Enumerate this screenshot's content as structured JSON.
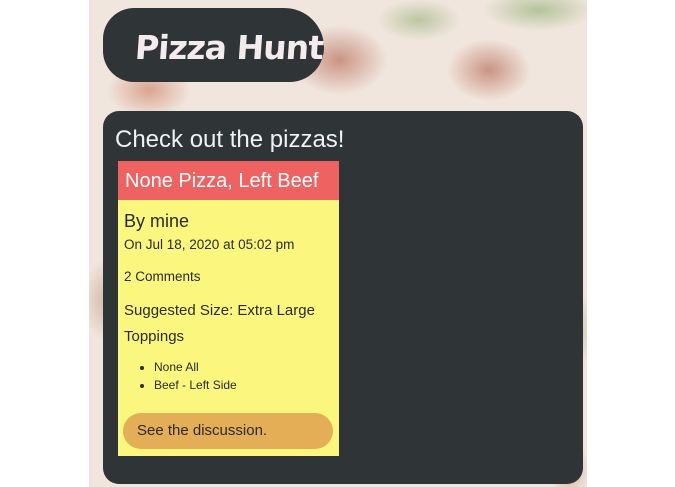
{
  "header": {
    "logo_text": "Pizza Hunt"
  },
  "main": {
    "heading": "Check out the pizzas!",
    "pizzas": [
      {
        "name": "None Pizza, Left Beef",
        "author": "By mine",
        "date": "On Jul 18, 2020 at 05:02 pm",
        "comments": "2 Comments",
        "size": "Suggested Size: Extra Large",
        "toppings_label": "Toppings",
        "toppings": [
          "None All",
          "Beef - Left Side"
        ],
        "discussion_button": "See the discussion."
      }
    ]
  },
  "colors": {
    "panel": "#2f3437",
    "card": "#fbf67d",
    "card_header": "#ef6262",
    "button": "#e4ae56"
  }
}
